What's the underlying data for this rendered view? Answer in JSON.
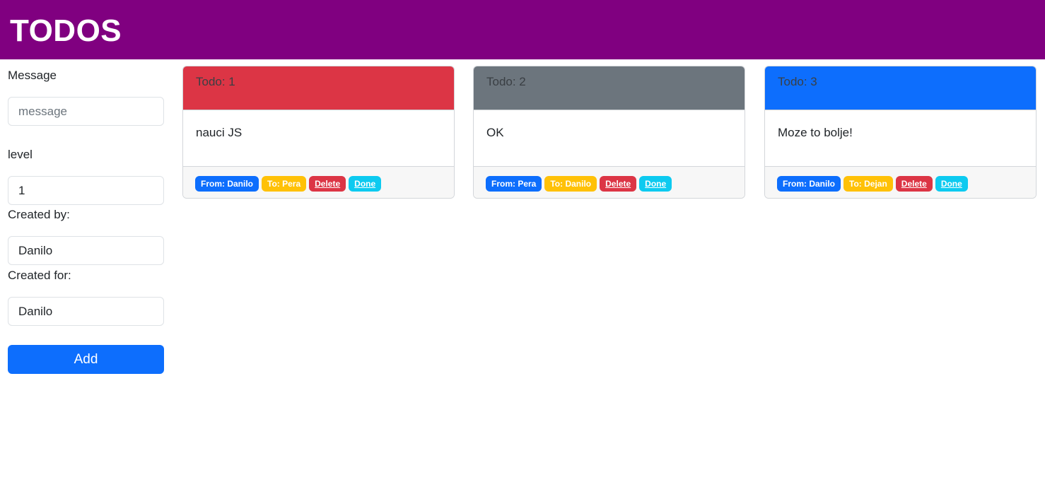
{
  "header": {
    "title": "TODOS",
    "bg_color": "#800080"
  },
  "form": {
    "message_label": "Message",
    "message_placeholder": "message",
    "message_value": "",
    "level_label": "level",
    "level_value": "1",
    "created_by_label": "Created by:",
    "created_by_value": "Danilo",
    "created_for_label": "Created for:",
    "created_for_value": "Danilo",
    "add_label": "Add"
  },
  "todos": [
    {
      "header": "Todo: 1",
      "message": "nauci JS",
      "from": "From: Danilo",
      "to": "To: Pera",
      "delete_label": "Delete",
      "done_label": "Done",
      "color": "#dc3545"
    },
    {
      "header": "Todo: 2",
      "message": "OK",
      "from": "From: Pera",
      "to": "To: Danilo",
      "delete_label": "Delete",
      "done_label": "Done",
      "color": "#6c757d"
    },
    {
      "header": "Todo: 3",
      "message": "Moze to bolje!",
      "from": "From: Danilo",
      "to": "To: Dejan",
      "delete_label": "Delete",
      "done_label": "Done",
      "color": "#0d6efd"
    }
  ]
}
